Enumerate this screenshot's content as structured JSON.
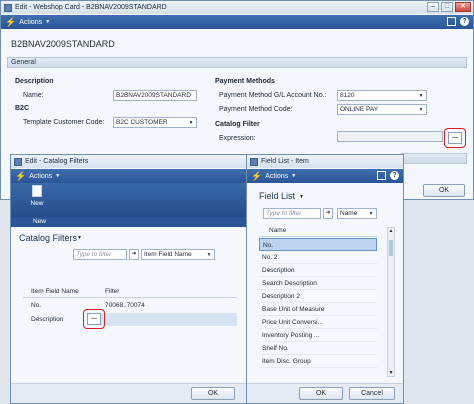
{
  "card": {
    "title": "Edit - Webshop Card - B2BNAV2009STANDARD",
    "actions_label": "Actions",
    "heading": "B2BNAV2009STANDARD",
    "general_label": "General",
    "description_section": "Description",
    "name_label": "Name:",
    "name_value": "B2BNAV2009STANDARD",
    "b2c_section": "B2C",
    "template_label": "Template Customer Code:",
    "template_value": "B2C CUSTOMER",
    "payment_section": "Payment Methods",
    "gl_label": "Payment Method G/L Account No.:",
    "gl_value": "8120",
    "pm_code_label": "Payment Method Code:",
    "pm_code_value": "ONLINE PAY",
    "catalog_section": "Catalog Filter",
    "expression_label": "Expression:",
    "ellipsis": "...",
    "ok_label": "OK"
  },
  "catalog": {
    "title": "Edit - Catalog Filters",
    "actions_label": "Actions",
    "new_label": "New",
    "new_group": "New",
    "heading": "Catalog Filters",
    "filter_placeholder": "Type to filter",
    "filter_field": "Item Field Name",
    "col_field": "Item Field Name",
    "col_filter": "Filter",
    "rows": [
      {
        "field": "No.",
        "filter": "70068..70074"
      },
      {
        "field": "Description",
        "filter": ""
      }
    ],
    "ellipsis": "...",
    "ok_label": "OK"
  },
  "fieldlist": {
    "title": "Field List - Item",
    "actions_label": "Actions",
    "heading": "Field List",
    "filter_placeholder": "Type to filter",
    "filter_field": "Name",
    "col_name": "Name",
    "items": [
      "No.",
      "No. 2",
      "Description",
      "Search Description",
      "Description 2",
      "Base Unit of Measure",
      "Price Unit Conversi...",
      "Inventory Posting ...",
      "Shelf No.",
      "Item Disc. Group"
    ],
    "ok_label": "OK",
    "cancel_label": "Cancel"
  },
  "colors": {
    "action_bar": "#2a5596",
    "highlight_ring": "#d21f2b",
    "selected_row": "#bcd4ef"
  }
}
